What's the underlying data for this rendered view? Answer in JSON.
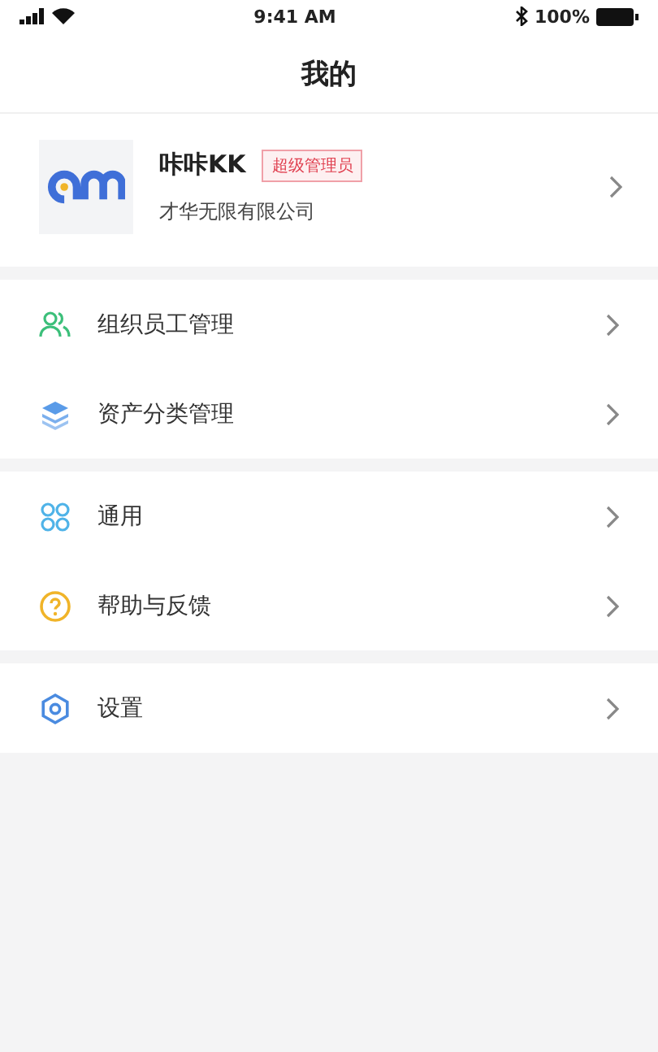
{
  "status_bar": {
    "time": "9:41 AM",
    "battery": "100%"
  },
  "title": "我的",
  "profile": {
    "name": "咔咔KK",
    "badge": "超级管理员",
    "company": "才华无限有限公司"
  },
  "groups": [
    {
      "items": [
        {
          "label": "组织员工管理"
        },
        {
          "label": "资产分类管理"
        }
      ]
    },
    {
      "items": [
        {
          "label": "通用"
        },
        {
          "label": "帮助与反馈"
        }
      ]
    },
    {
      "items": [
        {
          "label": "设置"
        }
      ]
    }
  ]
}
